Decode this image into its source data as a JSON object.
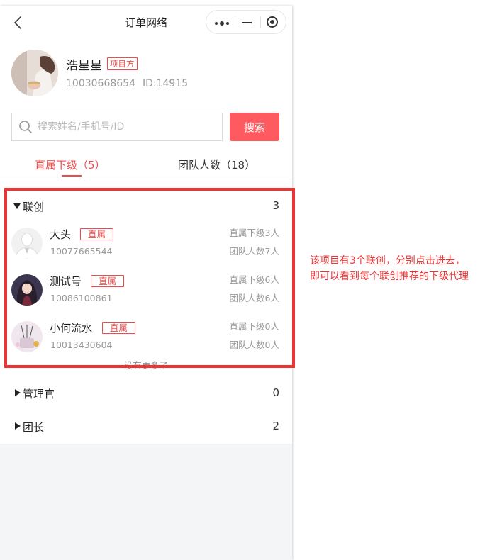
{
  "nav": {
    "title": "订单网络"
  },
  "profile": {
    "name": "浩星星",
    "role_tag": "项目方",
    "phone": "10030668654",
    "id_text": "ID:14915"
  },
  "search": {
    "placeholder": "搜索姓名/手机号/ID",
    "value": "",
    "button_label": "搜索"
  },
  "tabs": [
    {
      "label": "直属下级（5）",
      "active": true
    },
    {
      "label": "团队人数（18）",
      "active": false
    }
  ],
  "groups": [
    {
      "label": "联创",
      "count": "3",
      "expanded": true,
      "members": [
        {
          "name": "大头",
          "tag": "直属",
          "id": "10077665544",
          "direct_sub": "直属下级3人",
          "team_count": "团队人数7人"
        },
        {
          "name": "测试号",
          "tag": "直属",
          "id": "10086100861",
          "direct_sub": "直属下级6人",
          "team_count": "团队人数6人"
        },
        {
          "name": "小何流水",
          "tag": "直属",
          "id": "10013430604",
          "direct_sub": "直属下级0人",
          "team_count": "团队人数0人"
        }
      ],
      "footer": "没有更多了"
    },
    {
      "label": "管理官",
      "count": "0",
      "expanded": false
    },
    {
      "label": "团长",
      "count": "2",
      "expanded": false
    }
  ],
  "annotation": {
    "line1": "该项目有3个联创，分别点击进去，",
    "line2": "即可以看到每个联创推荐的下级代理",
    "color": "#ef3333"
  },
  "colors": {
    "accent": "#f04b4b",
    "search_button": "#ff5a5f"
  }
}
